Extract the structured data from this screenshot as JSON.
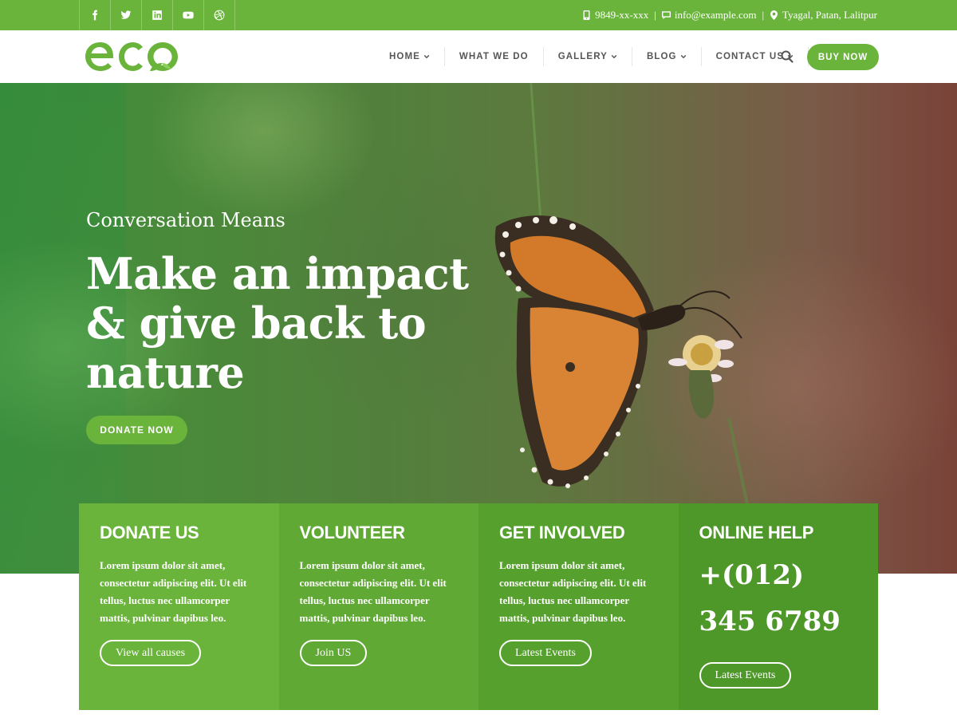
{
  "topbar": {
    "social": [
      "facebook-icon",
      "twitter-icon",
      "linkedin-icon",
      "youtube-icon",
      "dribbble-icon"
    ],
    "phone": "9849-xx-xxx",
    "email": "info@example.com",
    "address": "Tyagal, Patan, Lalitpur"
  },
  "header": {
    "logo_text": "eco",
    "nav": [
      {
        "label": "HOME",
        "dropdown": true
      },
      {
        "label": "WHAT WE DO",
        "dropdown": false
      },
      {
        "label": "GALLERY",
        "dropdown": true
      },
      {
        "label": "BLOG",
        "dropdown": true
      },
      {
        "label": "CONTACT US",
        "dropdown": true
      }
    ],
    "buy_label": "BUY NOW"
  },
  "hero": {
    "subtitle": "Conversation Means",
    "title": "Make an impact & give back to nature",
    "donate_label": "DONATE NOW"
  },
  "cards": [
    {
      "title": "DONATE US",
      "text": "Lorem ipsum dolor sit amet, consectetur adipiscing elit. Ut elit tellus, luctus nec ullamcorper mattis, pulvinar dapibus leo.",
      "button": "View all causes"
    },
    {
      "title": "VOLUNTEER",
      "text": "Lorem ipsum dolor sit amet, consectetur adipiscing elit. Ut elit tellus, luctus nec ullamcorper mattis, pulvinar dapibus leo.",
      "button": "Join US"
    },
    {
      "title": "GET INVOLVED",
      "text": "Lorem ipsum dolor sit amet, consectetur adipiscing elit. Ut elit tellus, luctus nec ullamcorper mattis, pulvinar dapibus leo.",
      "button": "Latest Events"
    },
    {
      "title": "ONLINE HELP",
      "phone": "+(012) 345 6789",
      "button": "Latest Events"
    }
  ],
  "colors": {
    "brand_green": "#6ab43c",
    "dark_green": "#4d9828"
  }
}
